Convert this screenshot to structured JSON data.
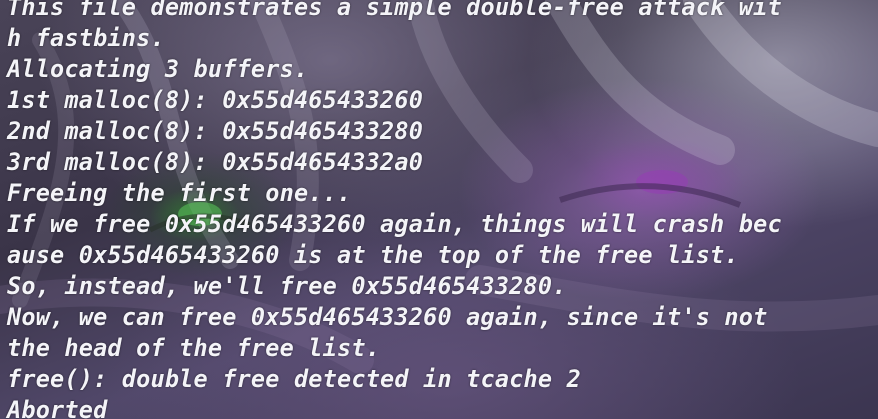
{
  "terminal": {
    "lines": [
      "This file demonstrates a simple double-free attack wit",
      "h fastbins.",
      "Allocating 3 buffers.",
      "1st malloc(8): 0x55d465433260",
      "2nd malloc(8): 0x55d465433280",
      "3rd malloc(8): 0x55d4654332a0",
      "Freeing the first one...",
      "If we free 0x55d465433260 again, things will crash bec",
      "ause 0x55d465433260 is at the top of the free list.",
      "So, instead, we'll free 0x55d465433280.",
      "Now, we can free 0x55d465433260 again, since it's not",
      "the head of the free list.",
      "free(): double free detected in tcache 2",
      "Aborted"
    ]
  }
}
